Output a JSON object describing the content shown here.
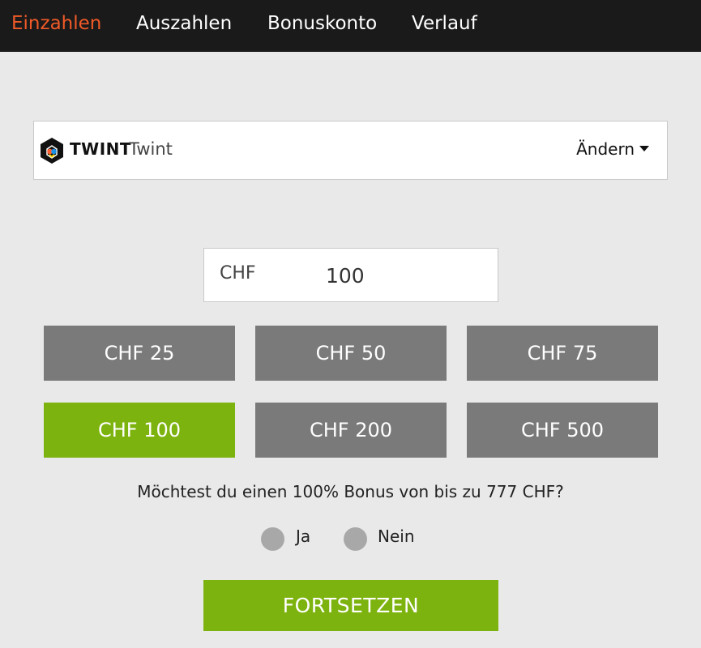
{
  "nav": {
    "tabs": [
      {
        "label": "Einzahlen",
        "active": true
      },
      {
        "label": "Auszahlen",
        "active": false
      },
      {
        "label": "Bonuskonto",
        "active": false
      },
      {
        "label": "Verlauf",
        "active": false
      }
    ]
  },
  "payment_method": {
    "brand": "TWINT",
    "name": "Twint",
    "icon": "twint-logo-icon",
    "change_label": "Ändern"
  },
  "amount": {
    "currency": "CHF",
    "value": "100"
  },
  "presets": [
    {
      "label": "CHF 25",
      "selected": false
    },
    {
      "label": "CHF 50",
      "selected": false
    },
    {
      "label": "CHF 75",
      "selected": false
    },
    {
      "label": "CHF 100",
      "selected": true
    },
    {
      "label": "CHF 200",
      "selected": false
    },
    {
      "label": "CHF 500",
      "selected": false
    }
  ],
  "bonus": {
    "question": "Möchtest du einen 100% Bonus von bis zu 777 CHF?",
    "options": [
      "Ja",
      "Nein"
    ]
  },
  "continue_label": "FORTSETZEN",
  "colors": {
    "accent_orange": "#f05a28",
    "accent_green": "#7db30f",
    "button_gray": "#7a7a7a",
    "nav_background": "#1a1a1a"
  }
}
